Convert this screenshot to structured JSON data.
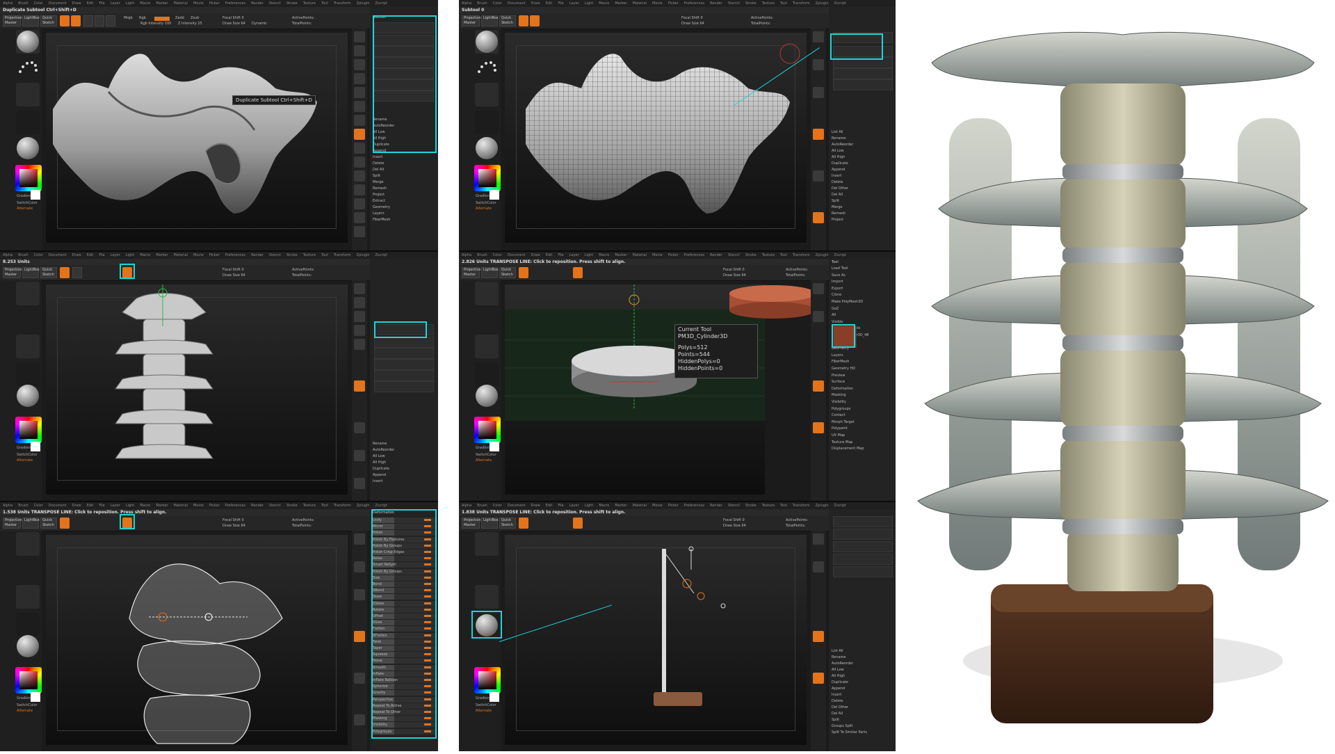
{
  "menu": [
    "Alpha",
    "Brush",
    "Color",
    "Document",
    "Draw",
    "Edit",
    "File",
    "Layer",
    "Light",
    "Macro",
    "Marker",
    "Material",
    "Movie",
    "Picker",
    "Preferences",
    "Render",
    "Stencil",
    "Stroke",
    "Texture",
    "Tool",
    "Transform",
    "Zplugin",
    "Zscript"
  ],
  "panels": {
    "a1": {
      "note": "Duplicate Subtool  Ctrl+Shift+D",
      "tooltip": "Duplicate Subtool  Ctrl+Shift+D",
      "tray_title": "Subtool",
      "tray_rows": [
        "Rename",
        "AutoReorder",
        "All Low",
        "All High",
        "Duplicate",
        "Append",
        "Insert",
        "Delete",
        "Del All",
        "Split",
        "Merge",
        "Remesh",
        "Project",
        "Extract",
        "Geometry",
        "Layers",
        "FiberMesh"
      ]
    },
    "a2": {
      "note": "8.253 Units",
      "tray_rows": [
        "Rename",
        "AutoReorder",
        "All Low",
        "All High",
        "Duplicate",
        "Append",
        "Insert"
      ]
    },
    "a3": {
      "note": "1.538 Units   TRANSPOSE LINE: Click to reposition. Press shift to align.",
      "tray_title": "Deformation",
      "deformation": [
        "Unify",
        "Mirror",
        "Polish",
        "Polish By Features",
        "Polish By Groups",
        "Polish Crisp Edges",
        "Relax",
        "Smart ReSym",
        "Polish By Groups",
        "Size",
        "Bend",
        "SBend",
        "Skew",
        "SSkew",
        "Rotate",
        "Offset",
        "SSize",
        "Flatten",
        "SFlatten",
        "Twist",
        "Taper",
        "Squeeze",
        "Noise",
        "Smooth",
        "Inflate",
        "Inflate Balloon",
        "Spherize",
        "Gravity",
        "Perspective",
        "Repeat To Active",
        "Repeat To Other",
        "Masking",
        "Visibility",
        "Polygroups"
      ]
    },
    "b1": {
      "note": "Subtool 0",
      "tray_rows": [
        "List All",
        "Rename",
        "AutoReorder",
        "All Low",
        "All High",
        "Duplicate",
        "Append",
        "Insert",
        "Delete",
        "Del Other",
        "Del All",
        "Split",
        "Merge",
        "Remesh",
        "Project"
      ]
    },
    "b2": {
      "note": "2.826 Units   TRANSPOSE LINE: Click to reposition. Press shift to align.",
      "tooltip_title": "Current Tool",
      "tooltip_name": "PM3D_Cylinder3D",
      "tooltip_lines": [
        "Polys=512",
        "Points=544",
        "HiddenPolys=0",
        "HiddenPoints=0"
      ],
      "tray_title": "Tool",
      "tray_rows": [
        "Load Tool",
        "Save As",
        "Import",
        "Export",
        "Clone",
        "Make PolyMesh3D",
        "GoZ",
        "All",
        "Visible",
        "Lightbox > Tools",
        "PM3D_Cylinder3D_48",
        "Subtool",
        "Geometry",
        "Layers",
        "FiberMesh",
        "Geometry HD",
        "Preview",
        "Surface",
        "Deformation",
        "Masking",
        "Visibility",
        "Polygroups",
        "Contact",
        "Morph Target",
        "Polypaint",
        "UV Map",
        "Texture Map",
        "Displacement Map"
      ]
    },
    "b3": {
      "note": "1.838 Units   TRANSPOSE LINE: Click to reposition. Press shift to align.",
      "tray_rows": [
        "List All",
        "Rename",
        "AutoReorder",
        "All Low",
        "All High",
        "Duplicate",
        "Append",
        "Insert",
        "Delete",
        "Del Other",
        "Del All",
        "Split",
        "Groups Split",
        "Split To Similar Parts"
      ]
    }
  },
  "toolbar": {
    "projection": "Projection Master",
    "lightbox": "LightBox",
    "quick_sketch": "Quick Sketch",
    "edit": "Edit",
    "draw": "Draw",
    "move": "Move",
    "scale": "Scale",
    "rotate": "Rotate",
    "mrgb": "Mrgb",
    "rgb": "Rgb",
    "m": "M",
    "zadd": "Zadd",
    "zsub": "Zsub",
    "zcut": "Zcut",
    "focal_shift": "Focal Shift 0",
    "draw_size": "Draw Size 64",
    "dynamic": "Dynamic",
    "active_points": "ActivePoints:",
    "total_points": "TotalPoints:",
    "rgb_intensity": "Rgb Intensity 100",
    "z_intensity": "Z Intensity 25"
  },
  "left_tray": {
    "gradient": "Gradient",
    "switch_color": "SwitchColor",
    "alternate": "Alternate"
  },
  "colors": {
    "accent": "#e3741c",
    "highlight": "#1fd5d8",
    "bg": "#1b1b1b"
  }
}
